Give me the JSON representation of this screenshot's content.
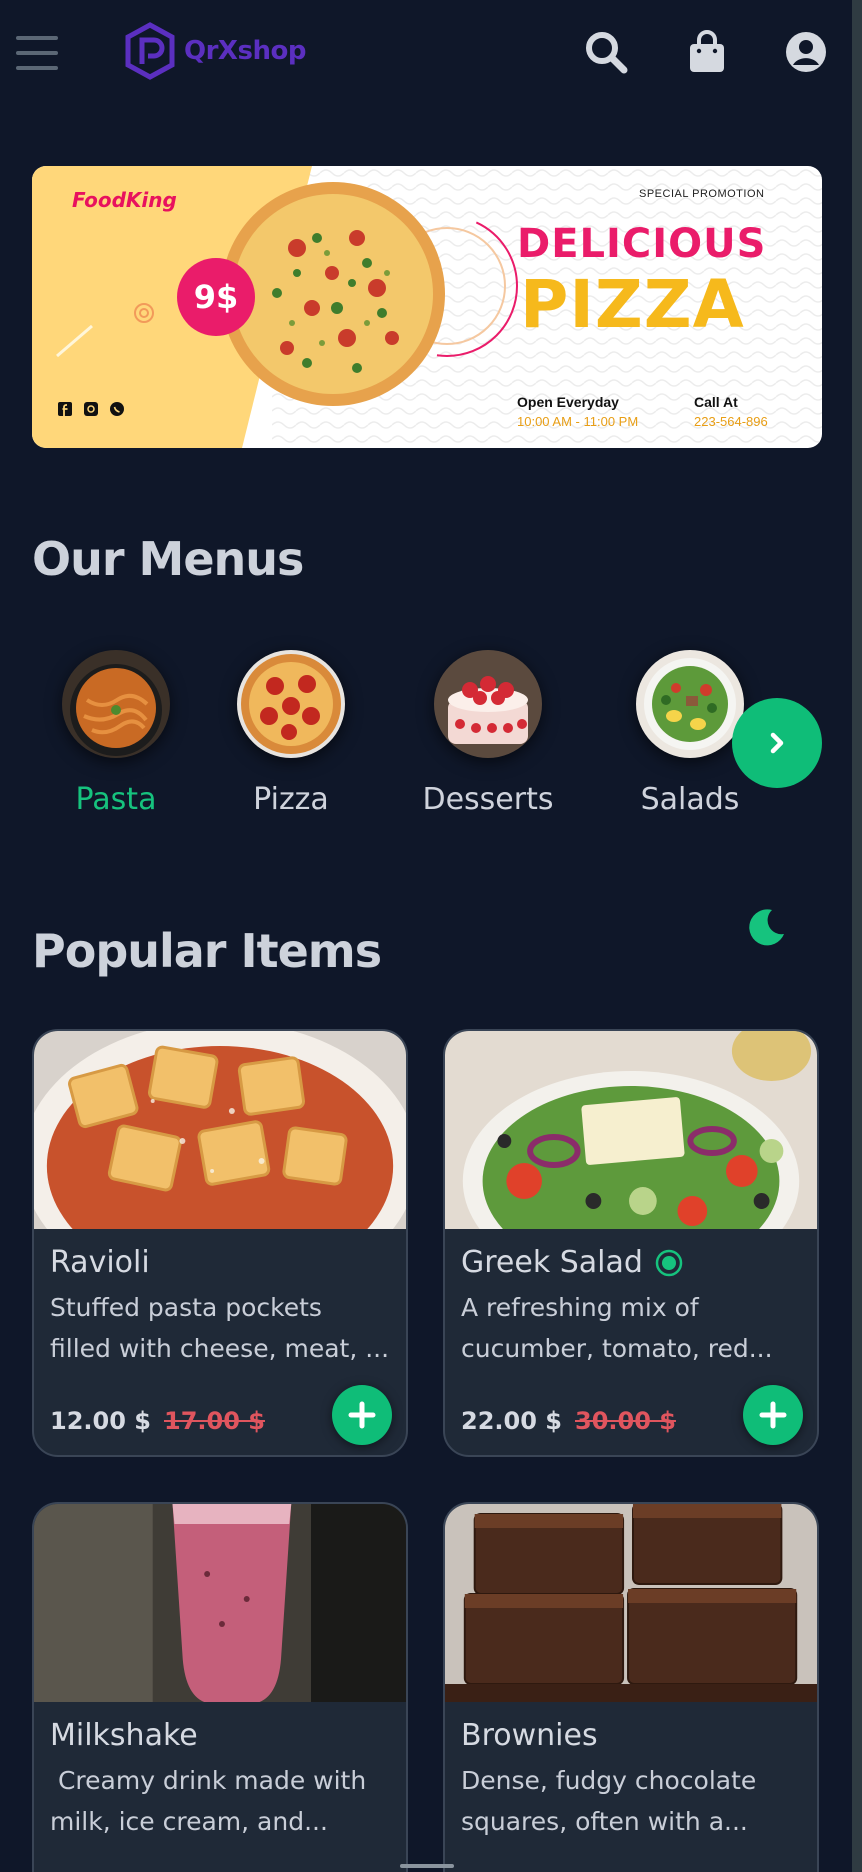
{
  "header": {
    "menu_icon": "hamburger-icon",
    "brand": "QrXshop",
    "brand_color": "#5b2fc0",
    "search_icon": "search-icon",
    "cart_icon": "shopping-bag-icon",
    "account_icon": "user-icon"
  },
  "banner": {
    "brand": "FoodKing",
    "promo_label": "SPECIAL PROMOTION",
    "headline_1": "DELICIOUS",
    "headline_2": "PIZZA",
    "price": "9$",
    "open_label": "Open Everyday",
    "open_hours": "10:00 AM - 11:00 PM",
    "call_label": "Call At",
    "call_number": "223-564-896",
    "social_icons": [
      "facebook-icon",
      "instagram-icon",
      "whatsapp-icon"
    ]
  },
  "menus": {
    "title": "Our Menus",
    "items": [
      {
        "label": "Pasta",
        "active": true
      },
      {
        "label": "Pizza",
        "active": false
      },
      {
        "label": "Desserts",
        "active": false
      },
      {
        "label": "Salads",
        "active": false
      }
    ],
    "next_icon": "chevron-right-icon"
  },
  "popular": {
    "title": "Popular Items",
    "theme_icon": "moon-icon",
    "items": [
      {
        "name": "Ravioli",
        "description": "Stuffed pasta pockets filled with cheese, meat, ...",
        "price": "12.00 $",
        "old_price": "17.00 $",
        "veg": false
      },
      {
        "name": "Greek Salad",
        "description": "A refreshing mix of cucumber, tomato, red...",
        "price": "22.00 $",
        "old_price": "30.00 $",
        "veg": true
      },
      {
        "name": "Milkshake",
        "description": " Creamy drink made with milk, ice cream, and...",
        "price": "",
        "old_price": "",
        "veg": false
      },
      {
        "name": "Brownies",
        "description": "Dense, fudgy chocolate squares, often with a...",
        "price": "",
        "old_price": "",
        "veg": false
      }
    ]
  },
  "colors": {
    "background": "#0f1729",
    "card": "#1f2937",
    "accent": "#0fbd78",
    "old_price": "#e0555e"
  }
}
